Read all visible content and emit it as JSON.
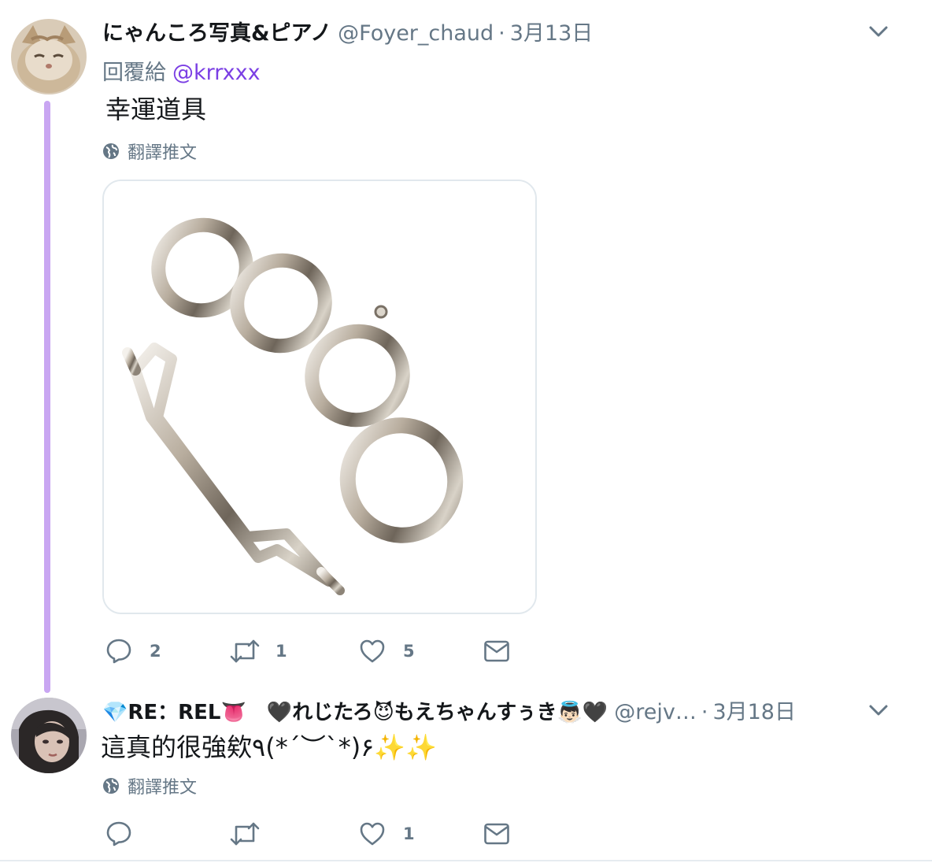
{
  "tweet1": {
    "display_name": "にゃんころ写真&ピアノ",
    "handle": "@Foyer_chaud",
    "separator": "·",
    "date": "3月13日",
    "reply_label": "回覆給",
    "reply_mention": "@krrxxx",
    "text": "幸運道具",
    "translate_label": "翻譯推文",
    "media_alt": "brass knuckles photo",
    "reply_count": "2",
    "retweet_count": "1",
    "like_count": "5"
  },
  "tweet2": {
    "display_name": "💎RE：REL👅　🖤れじたろ😈もえちゃんすぅき👼🏻🖤",
    "handle": "@rejv…",
    "separator": "·",
    "date": "3月18日",
    "text": "這真的很強欸٩(*´︶`*)۶✨✨",
    "translate_label": "翻譯推文",
    "like_count": "1"
  },
  "icons": {
    "reply": "reply-icon",
    "retweet": "retweet-icon",
    "like": "heart-icon",
    "dm": "envelope-icon",
    "globe": "globe-icon",
    "chevron": "chevron-down-icon"
  },
  "colors": {
    "thread_line": "#c9a6f2",
    "mention": "#7b3fe4",
    "muted": "#657786",
    "text": "#14171a"
  }
}
